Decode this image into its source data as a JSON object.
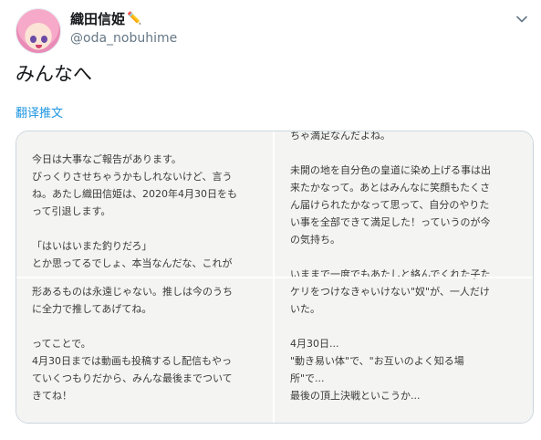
{
  "user": {
    "display_name": "織田信姫",
    "name_emoji": "✏️",
    "handle": "@oda_nobuhime"
  },
  "icons": [
    "chevron-down-icon"
  ],
  "tweet": {
    "text": "みんなへ",
    "translate_label": "翻译推文"
  },
  "images": {
    "top_left": "今日は大事なご報告があります。\nびっくりさせちゃうかもしれないけど、言う\nね。あたし織田信姫は、2020年4月30日をも\nって引退します。\n\n「はいはいまた釣りだろ」\nとか思ってるでしょ、本当なんだな、これが",
    "bottom_left": "形あるものは永遠じゃない。推しは今のうち\nに全力で推してあげてね。\n\nってことで。\n4月30日までは動画も投稿するし配信もやっ\nていくつもりだから、みんな最後までついて\nきてね！",
    "right": "ちゃ満足なんだよね。\n\n未開の地を自分色の皇道に染め上げる事は出\n来たかなって。あとはみんなに笑顔もたくさ\nん届けられたかなって思って、自分のやりた\nい事を全部できて満足した！っていうのが今\nの気持ち。\n\nいままで一度でもあたしと絡んでくれた子た\nケリをつけなきゃいけない\"奴\"が、一人だけ\nいた。\n\n4月30日...\n\"動き易い体\"で、\"お互いのよく知る場\n所\"で...\n最後の頂上決戦といこうか...\n\n犬山たまき。"
  },
  "colors": {
    "link": "#1b95e0",
    "handle": "#657786",
    "border": "#ccd6dd",
    "panel_bg": "#f4f4f3"
  }
}
